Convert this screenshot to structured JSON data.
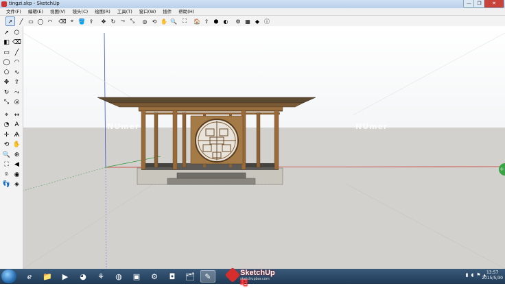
{
  "window": {
    "title": "tingzi.skp - SketchUp",
    "minimize": "—",
    "maximize": "❐",
    "close": "✕"
  },
  "menu": [
    "文件(F)",
    "编辑(E)",
    "视图(V)",
    "镜头(C)",
    "绘图(R)",
    "工具(T)",
    "窗口(W)",
    "插件",
    "帮助(H)"
  ],
  "toolbar_top": [
    {
      "name": "select-icon",
      "glyph": "➚",
      "selected": true
    },
    {
      "name": "line-icon",
      "glyph": "╱"
    },
    {
      "name": "rectangle-icon",
      "glyph": "▭"
    },
    {
      "name": "circle-icon",
      "glyph": "◯"
    },
    {
      "name": "arc-icon",
      "glyph": "◠"
    },
    {
      "name": "eraser-icon",
      "glyph": "⌫"
    },
    {
      "name": "tape-measure-icon",
      "glyph": "⌖"
    },
    {
      "name": "paint-bucket-icon",
      "glyph": "🪣"
    },
    {
      "name": "push-pull-icon",
      "glyph": "⇪"
    },
    {
      "name": "move-icon",
      "glyph": "✥"
    },
    {
      "name": "rotate-icon",
      "glyph": "↻"
    },
    {
      "name": "follow-me-icon",
      "glyph": "⤳"
    },
    {
      "name": "scale-icon",
      "glyph": "⤡"
    },
    {
      "name": "offset-icon",
      "glyph": "◎"
    },
    {
      "name": "orbit-icon",
      "glyph": "⟲"
    },
    {
      "name": "pan-icon",
      "glyph": "✋"
    },
    {
      "name": "zoom-icon",
      "glyph": "🔍"
    },
    {
      "name": "zoom-extents-icon",
      "glyph": "⛶"
    },
    {
      "name": "get-models-icon",
      "glyph": "🏠"
    },
    {
      "name": "share-model-icon",
      "glyph": "⇧"
    },
    {
      "name": "components-icon",
      "glyph": "⬢"
    },
    {
      "name": "styles-icon",
      "glyph": "◐"
    },
    {
      "name": "extension-icon",
      "glyph": "⚙"
    },
    {
      "name": "layout-icon",
      "glyph": "▦"
    },
    {
      "name": "materials-icon",
      "glyph": "◆"
    },
    {
      "name": "model-info-icon",
      "glyph": "ⓘ"
    }
  ],
  "toolbar_left": [
    {
      "name": "select-icon",
      "glyph": "➚"
    },
    {
      "name": "make-component-icon",
      "glyph": "⬡"
    },
    {
      "name": "paint-bucket-icon",
      "glyph": "◧"
    },
    {
      "name": "eraser-icon",
      "glyph": "⌫"
    },
    {
      "name": "rectangle-icon",
      "glyph": "▭"
    },
    {
      "name": "line-icon",
      "glyph": "╱"
    },
    {
      "name": "circle-icon",
      "glyph": "◯"
    },
    {
      "name": "arc-icon",
      "glyph": "◠"
    },
    {
      "name": "polygon-icon",
      "glyph": "⬠"
    },
    {
      "name": "freehand-icon",
      "glyph": "∿"
    },
    {
      "name": "move-icon",
      "glyph": "✥"
    },
    {
      "name": "push-pull-icon",
      "glyph": "⇪"
    },
    {
      "name": "rotate-icon",
      "glyph": "↻"
    },
    {
      "name": "follow-me-icon",
      "glyph": "⤳"
    },
    {
      "name": "scale-icon",
      "glyph": "⤡"
    },
    {
      "name": "offset-icon",
      "glyph": "◎"
    },
    {
      "name": "tape-measure-icon",
      "glyph": "⌖"
    },
    {
      "name": "dimension-icon",
      "glyph": "↔"
    },
    {
      "name": "protractor-icon",
      "glyph": "◔"
    },
    {
      "name": "text-icon",
      "glyph": "A"
    },
    {
      "name": "axes-icon",
      "glyph": "✛"
    },
    {
      "name": "3d-text-icon",
      "glyph": "Ѧ"
    },
    {
      "name": "orbit-icon",
      "glyph": "⟲"
    },
    {
      "name": "pan-icon",
      "glyph": "✋"
    },
    {
      "name": "zoom-icon",
      "glyph": "🔍"
    },
    {
      "name": "zoom-window-icon",
      "glyph": "⊕"
    },
    {
      "name": "zoom-extents-icon",
      "glyph": "⛶"
    },
    {
      "name": "previous-view-icon",
      "glyph": "◀"
    },
    {
      "name": "position-camera-icon",
      "glyph": "⌾"
    },
    {
      "name": "look-around-icon",
      "glyph": "◉"
    },
    {
      "name": "walk-icon",
      "glyph": "👣"
    },
    {
      "name": "section-plane-icon",
      "glyph": "◈"
    }
  ],
  "viewport": {
    "watermarks": [
      "NUmer",
      "NUmer"
    ],
    "axis_colors": {
      "red": "#c8302a",
      "green": "#2f9a3a",
      "blue": "#3a55c8"
    },
    "sky_color": "#ffffff",
    "ground_color": "#d2d1cd"
  },
  "taskbar": {
    "apps": [
      {
        "name": "ie-icon",
        "glyph": "ℯ"
      },
      {
        "name": "folder-icon",
        "glyph": "📁"
      },
      {
        "name": "media-player-icon",
        "glyph": "▶"
      },
      {
        "name": "qq-icon",
        "glyph": "◕"
      },
      {
        "name": "app-icon",
        "glyph": "⚘"
      },
      {
        "name": "firefox-icon",
        "glyph": "◍"
      },
      {
        "name": "pdf-icon",
        "glyph": "▣"
      },
      {
        "name": "settings-icon",
        "glyph": "⚙"
      },
      {
        "name": "camera-icon",
        "glyph": "◘"
      },
      {
        "name": "explorer-icon",
        "glyph": "🗂"
      },
      {
        "name": "sketchup-icon",
        "glyph": "✎",
        "active": true
      }
    ],
    "logo_text": "SketchUp",
    "logo_badge": "吧",
    "logo_sub": "sketchupbar.com",
    "clock_time": "13:57",
    "clock_date": "2015/5/30"
  }
}
